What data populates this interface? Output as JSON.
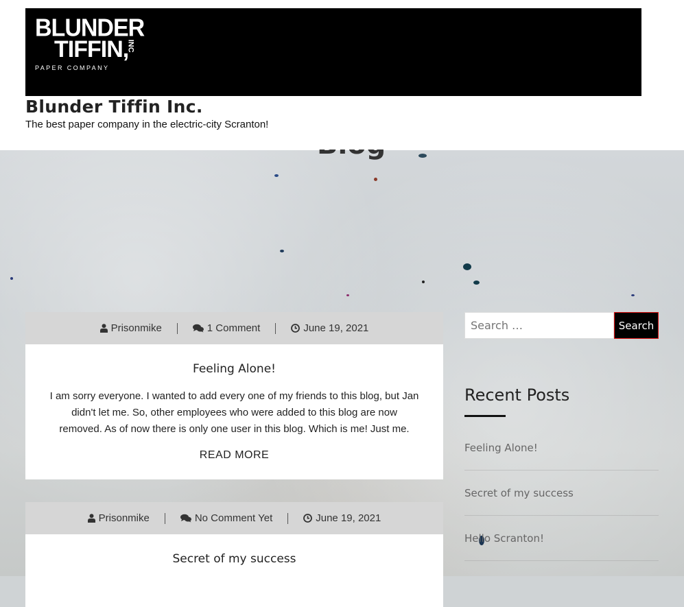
{
  "site": {
    "logo": {
      "line1": "BLUNDER",
      "line2": "TIFFIN,",
      "inc": "INC",
      "sub": "PAPER COMPANY"
    },
    "title": "Blunder Tiffin Inc.",
    "tagline": "The best paper company in the electric-city Scranton!"
  },
  "page": {
    "heading": "Blog"
  },
  "posts": [
    {
      "author": "Prisonmike",
      "comments": "1 Comment",
      "date": "June 19, 2021",
      "title": "Feeling Alone!",
      "excerpt": "I am sorry everyone. I wanted to add every one of my friends to this blog, but Jan didn't let me. So, other employees who were added to this blog are now removed. As of now there is only one user in this blog. Which is me! Just me.",
      "read_more": "READ MORE"
    },
    {
      "author": "Prisonmike",
      "comments": "No Comment Yet",
      "date": "June 19, 2021",
      "title": "Secret of my success"
    }
  ],
  "sidebar": {
    "search": {
      "placeholder": "Search …",
      "button": "Search"
    },
    "recent_title": "Recent Posts",
    "recent_posts": [
      "Feeling Alone!",
      "Secret of my success",
      "Hello Scranton!"
    ]
  },
  "icons": {
    "author": "user-icon",
    "comments": "comments-icon",
    "date": "clock-icon"
  }
}
